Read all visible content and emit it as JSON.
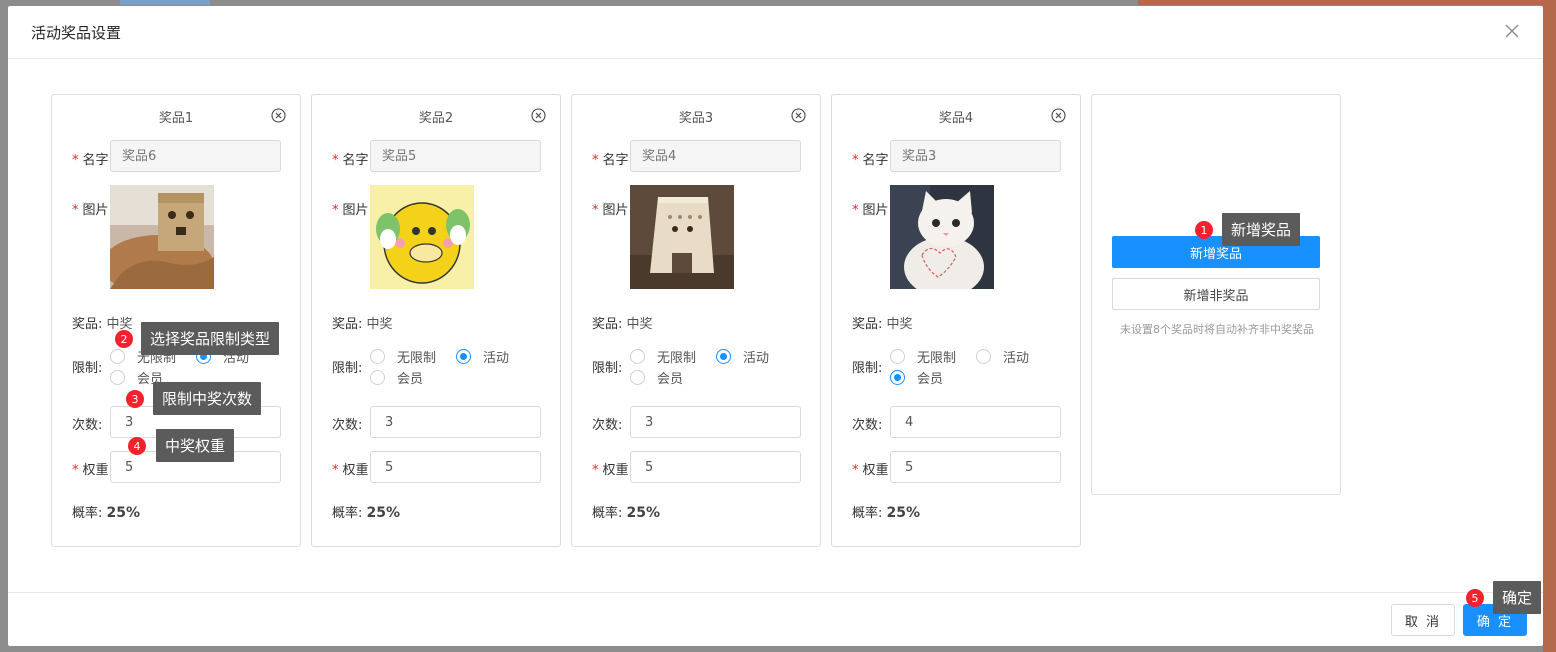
{
  "modal": {
    "title": "活动奖品设置",
    "cancel_label": "取 消",
    "ok_label": "确 定"
  },
  "labels": {
    "name": "名字",
    "image": "图片",
    "prize": "奖品:",
    "limit": "限制:",
    "count": "次数:",
    "weight": "权重",
    "probability": "概率:",
    "opt_unlimited": "无限制",
    "opt_activity": "活动",
    "opt_member": "会员"
  },
  "prizes": [
    {
      "title": "奖品1",
      "name_placeholder": "奖品6",
      "prize_value": "中奖",
      "limit": "activity",
      "count": "3",
      "weight": "5",
      "probability": "25%"
    },
    {
      "title": "奖品2",
      "name_placeholder": "奖品5",
      "prize_value": "中奖",
      "limit": "activity",
      "count": "3",
      "weight": "5",
      "probability": "25%"
    },
    {
      "title": "奖品3",
      "name_placeholder": "奖品4",
      "prize_value": "中奖",
      "limit": "activity",
      "count": "3",
      "weight": "5",
      "probability": "25%"
    },
    {
      "title": "奖品4",
      "name_placeholder": "奖品3",
      "prize_value": "中奖",
      "limit": "member",
      "count": "4",
      "weight": "5",
      "probability": "25%"
    }
  ],
  "add_panel": {
    "add_prize_label": "新增奖品",
    "add_non_prize_label": "新增非奖品",
    "hint": "未设置8个奖品时将自动补齐非中奖奖品"
  },
  "callouts": [
    {
      "num": "1",
      "text": "新增奖品"
    },
    {
      "num": "2",
      "text": "选择奖品限制类型"
    },
    {
      "num": "3",
      "text": "限制中奖次数"
    },
    {
      "num": "4",
      "text": "中奖权重"
    },
    {
      "num": "5",
      "text": "确定"
    }
  ],
  "colors": {
    "primary": "#1890ff",
    "required": "#f5222d",
    "callout_bg": "#5b5b5b"
  }
}
